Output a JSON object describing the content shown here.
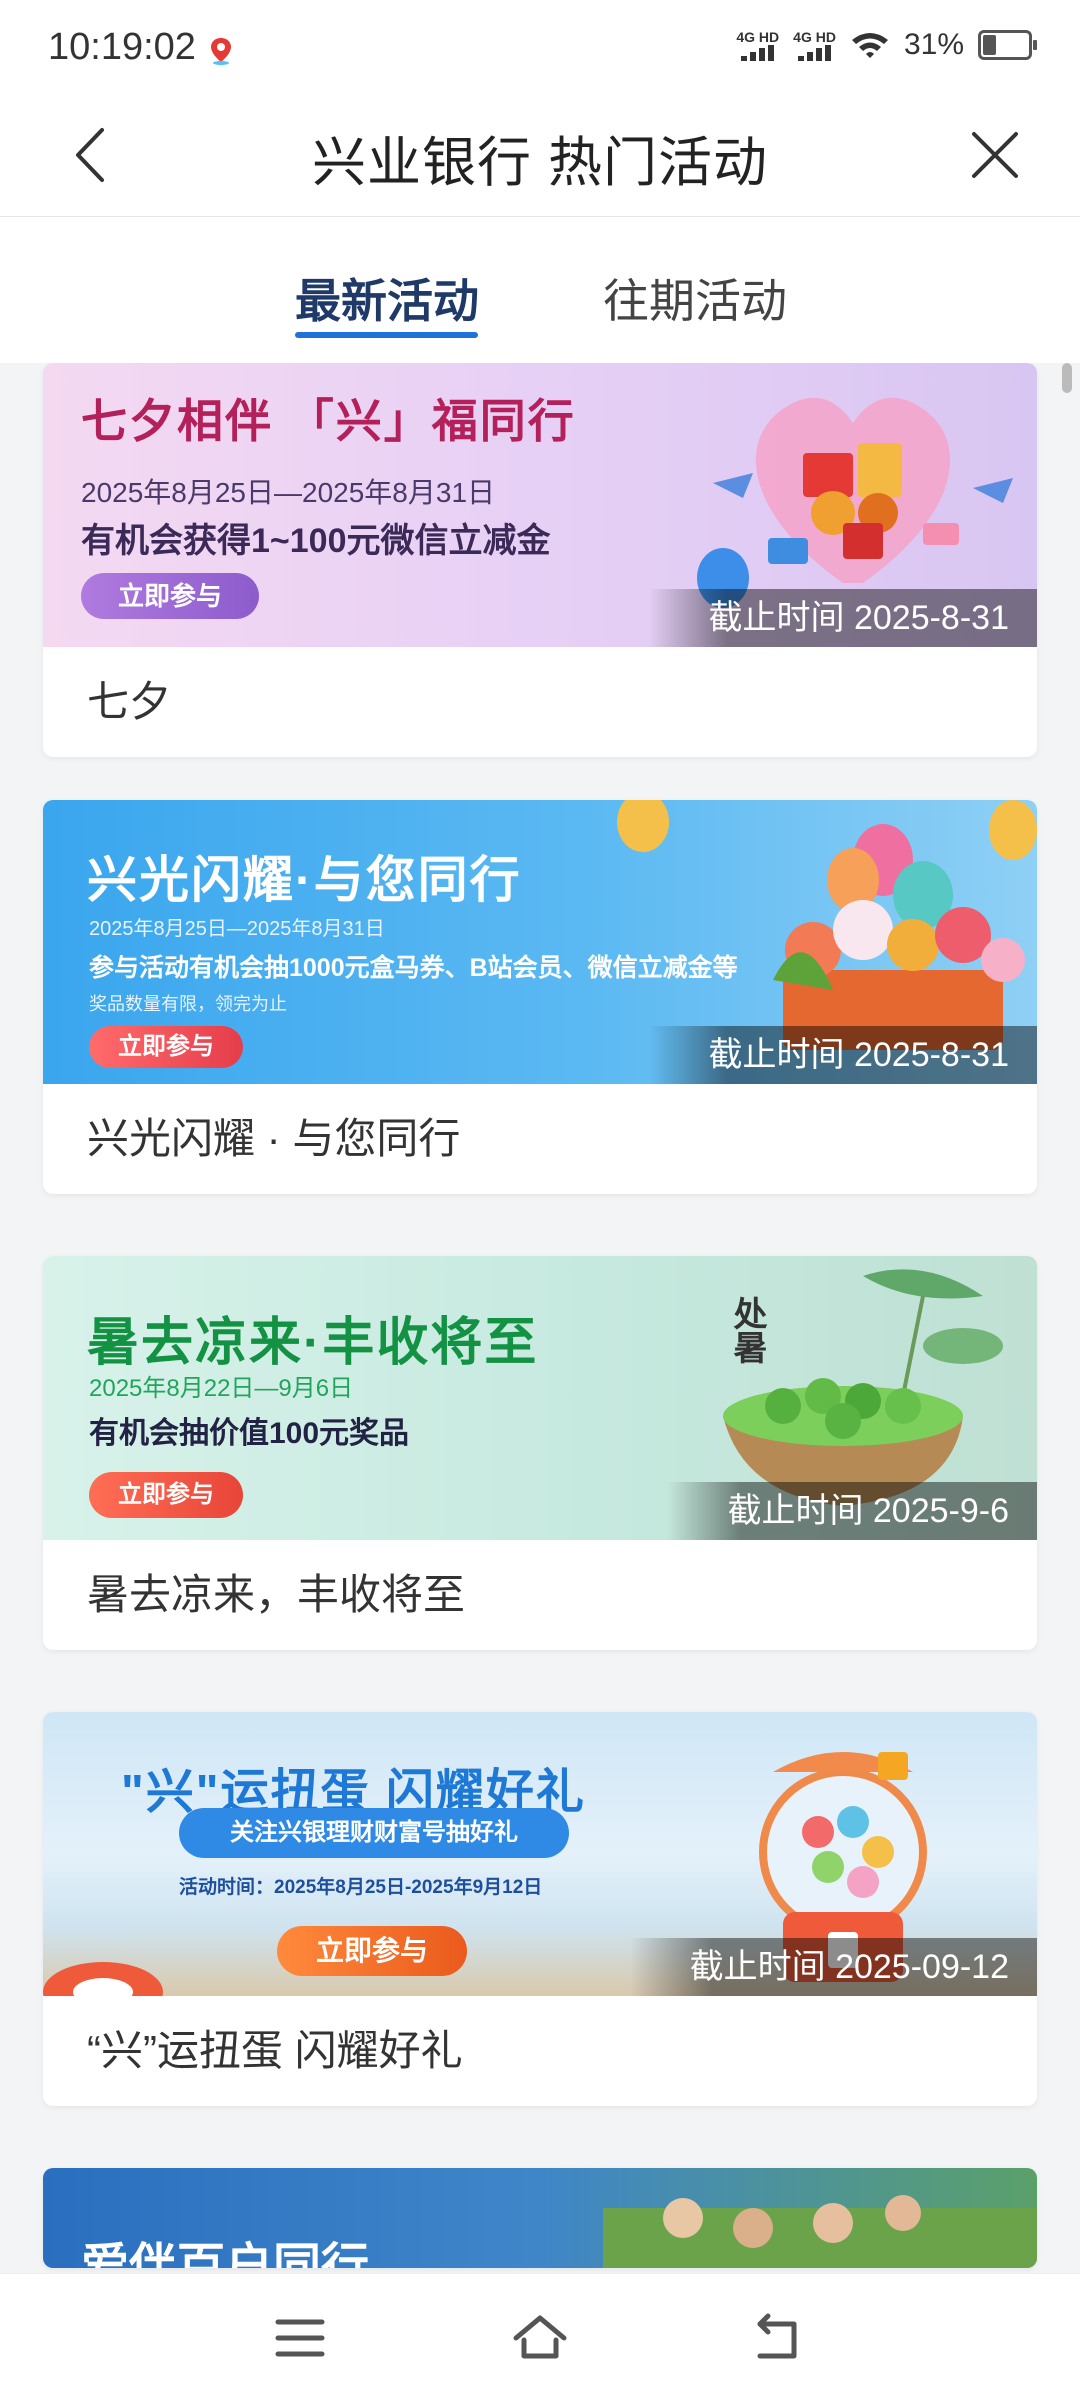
{
  "status_bar": {
    "time": "10:19:02",
    "sim1": "4G HD",
    "sim2": "4G HD",
    "battery_pct": "31%",
    "battery_level": 0.31
  },
  "header": {
    "title": "兴业银行 热门活动"
  },
  "tabs": [
    {
      "label": "最新活动",
      "active": true
    },
    {
      "label": "往期活动",
      "active": false
    }
  ],
  "cards": [
    {
      "banner_title": "七夕相伴 「兴」福同行",
      "banner_date": "2025年8月25日—2025年8月31日",
      "banner_desc": "有机会获得1~100元微信立减金",
      "banner_button": "立即参与",
      "deadline": "截止时间 2025-8-31",
      "title": "七夕"
    },
    {
      "banner_title": "兴光闪耀·与您同行",
      "banner_date": "2025年8月25日—2025年8月31日",
      "banner_desc": "参与活动有机会抽1000元盒马券、B站会员、微信立减金等",
      "banner_note": "奖品数量有限，领完为止",
      "banner_button": "立即参与",
      "deadline": "截止时间 2025-8-31",
      "title": "兴光闪耀 · 与您同行"
    },
    {
      "banner_title": "暑去凉来·丰收将至",
      "banner_date": "2025年8月22日—9月6日",
      "banner_desc": "有机会抽价值100元奖品",
      "banner_button": "立即参与",
      "banner_badge": "处暑",
      "deadline": "截止时间 2025-9-6",
      "title": "暑去凉来，丰收将至"
    },
    {
      "banner_title": "\"兴\"运扭蛋 闪耀好礼",
      "banner_pill": "关注兴银理财财富号抽好礼",
      "banner_date": "活动时间：2025年8月25日-2025年9月12日",
      "banner_button": "立即参与",
      "deadline": "截止时间 2025-09-12",
      "title": "“兴”运扭蛋 闪耀好礼"
    },
    {
      "banner_title": "爱伴百户同行"
    }
  ],
  "nav": {
    "menu_icon": "menu-icon",
    "home_icon": "home-icon",
    "back_icon": "back-icon"
  }
}
